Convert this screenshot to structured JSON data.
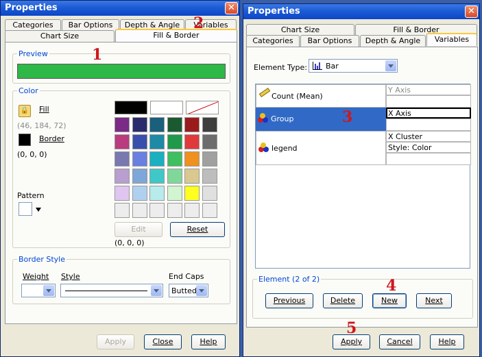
{
  "left": {
    "title": "Properties",
    "tabs_row1": [
      "Categories",
      "Bar Options",
      "Depth & Angle",
      "Variables"
    ],
    "tabs_row2": [
      "Chart Size",
      "Fill & Border"
    ],
    "preview_label": "Preview",
    "preview_color": "#2eb848",
    "color_label": "Color",
    "fill_label": "Fill",
    "fill_rgb": "(46, 184, 72)",
    "border_label": "Border",
    "border_rgb": "(0, 0, 0)",
    "pattern_label": "Pattern",
    "edit_label": "Edit",
    "reset_label": "Reset",
    "selected_rgb": "(0, 0, 0)",
    "palette": [
      [
        "#7b2b86",
        "#2a2a6d",
        "#1a5f7b",
        "#1b5a31",
        "#9a1b1b",
        "#3e3e3e"
      ],
      [
        "#bb3b80",
        "#3a4fab",
        "#1e8aa6",
        "#1f9a4a",
        "#e03a3a",
        "#6d6d6d"
      ],
      [
        "#7a78b0",
        "#6a7fe0",
        "#1ab0c0",
        "#3fbf5f",
        "#f0901e",
        "#a0a0a0"
      ],
      [
        "#b89fcf",
        "#7fa6d8",
        "#3fc8c8",
        "#7fd89a",
        "#d9c88f",
        "#bdbdbd"
      ],
      [
        "#e0c5f0",
        "#b0d0f0",
        "#b8ebeb",
        "#d0f5d0",
        "#ffff20",
        "#e0e0e0"
      ],
      [
        "#ededed",
        "#ededed",
        "#ededed",
        "#ededed",
        "#ededed",
        "#ededed"
      ]
    ],
    "border_style_label": "Border Style",
    "weight_label": "Weight",
    "style_label": "Style",
    "endcaps_label": "End Caps",
    "endcaps_value": "Butted",
    "apply_label": "Apply",
    "close_label": "Close",
    "help_label": "Help"
  },
  "right": {
    "title": "Properties",
    "tabs_row1": [
      "Chart Size",
      "Fill & Border"
    ],
    "tabs_row2": [
      "Categories",
      "Bar Options",
      "Depth & Angle",
      "Variables"
    ],
    "element_type_label": "Element Type:",
    "element_type_value": "Bar",
    "rows": [
      {
        "name": "Count (Mean)",
        "role": "Y Axis",
        "role2": ""
      },
      {
        "name": "Group",
        "role": "X Axis",
        "role2": ""
      },
      {
        "name": "legend",
        "role": "X Cluster",
        "role2": "Style: Color"
      }
    ],
    "element_label": "Element (2 of 2)",
    "previous_label": "Previous",
    "delete_label": "Delete",
    "new_label": "New",
    "next_label": "Next",
    "apply_label": "Apply",
    "cancel_label": "Cancel",
    "help_label": "Help"
  },
  "annotations": [
    "1",
    "2",
    "3",
    "4",
    "5"
  ]
}
